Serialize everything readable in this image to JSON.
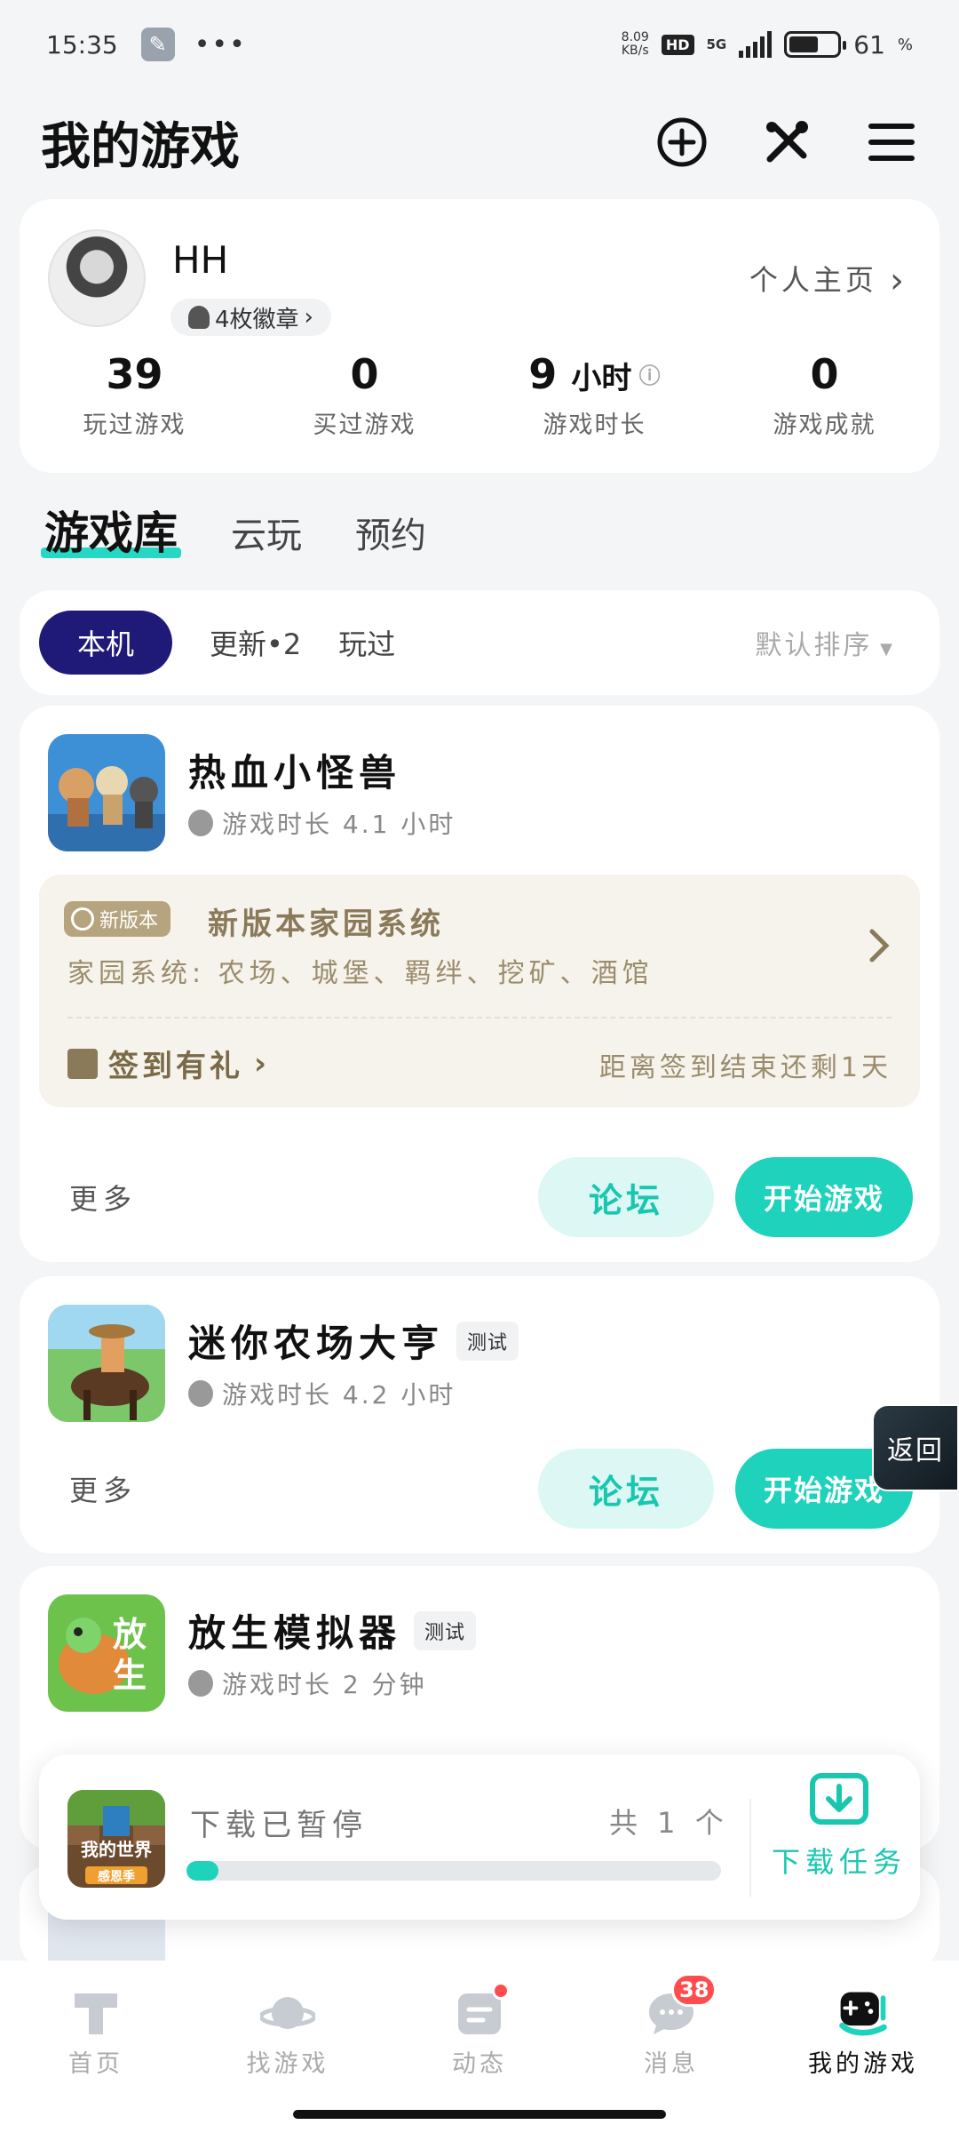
{
  "status_bar": {
    "time": "15:35",
    "net_speed": "8.09",
    "net_unit": "KB/s",
    "hd": "HD",
    "network": "5G",
    "battery": "61",
    "battery_level": 0.61
  },
  "header": {
    "title": "我的游戏"
  },
  "profile": {
    "username": "HH",
    "badges": "4枚徽章",
    "home_link": "个人主页",
    "stats": [
      {
        "num": "39",
        "unit": "",
        "label": "玩过游戏"
      },
      {
        "num": "0",
        "unit": "",
        "label": "买过游戏"
      },
      {
        "num": "9",
        "unit": "小时",
        "label": "游戏时长"
      },
      {
        "num": "0",
        "unit": "",
        "label": "游戏成就"
      }
    ]
  },
  "library_tabs": [
    "游戏库",
    "云玩",
    "预约"
  ],
  "filters": {
    "chips": [
      "本机",
      "更新•2",
      "玩过"
    ],
    "sort": "默认排序"
  },
  "games": [
    {
      "name": "热血小怪兽",
      "tag": "",
      "playtime": "游戏时长 4.1 小时",
      "update": {
        "tag": "新版本",
        "title": "新版本家园系统",
        "desc": "家园系统: 农场、城堡、羁绊、挖矿、酒馆",
        "signin": "签到有礼",
        "countdown": "距离签到结束还剩1天"
      },
      "more": "更多",
      "forum": "论坛",
      "play": "开始游戏"
    },
    {
      "name": "迷你农场大亨",
      "tag": "测试",
      "playtime": "游戏时长 4.2 小时",
      "more": "更多",
      "forum": "论坛",
      "play": "开始游戏"
    },
    {
      "name": "放生模拟器",
      "tag": "测试",
      "playtime": "游戏时长 2 分钟"
    }
  ],
  "float_back": "返回",
  "download": {
    "status": "下载已暂停",
    "count": "共 1 个",
    "task": "下载任务",
    "icon_text": "我的世界",
    "icon_sub": "感恩季",
    "progress": 0.06
  },
  "bottom_nav": [
    {
      "label": "首页"
    },
    {
      "label": "找游戏"
    },
    {
      "label": "动态"
    },
    {
      "label": "消息",
      "badge": "38"
    },
    {
      "label": "我的游戏"
    }
  ],
  "colors": {
    "accent": "#1ed2bc",
    "chip_active": "#1f1a78",
    "badge": "#ff4d4f"
  }
}
